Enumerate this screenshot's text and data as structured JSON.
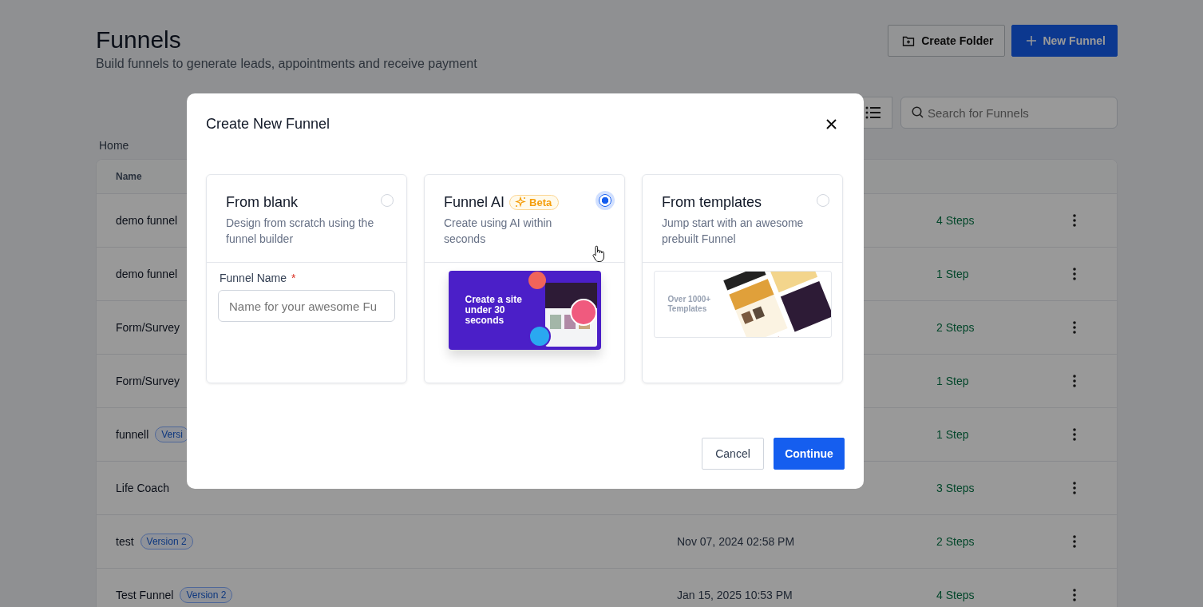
{
  "page": {
    "title": "Funnels",
    "subtitle": "Build funnels to generate leads, appointments and receive payment"
  },
  "actions": [
    {
      "kind": "secondary",
      "label": "Create Folder"
    },
    {
      "kind": "primary",
      "label": "New Funnel"
    }
  ],
  "search": {
    "placeholder": "Search for Funnels"
  },
  "breadcrumb": "Home",
  "table": {
    "columns": [
      "Name"
    ],
    "rows": [
      {
        "name": "demo funnel",
        "steps": "4 Steps"
      },
      {
        "name": "demo funnel",
        "steps": "1 Step"
      },
      {
        "name": "Form/Survey",
        "steps": "2 Steps"
      },
      {
        "name": "Form/Survey",
        "steps": "1 Step"
      },
      {
        "name": "funnell",
        "badge": "Versi",
        "steps": "1 Step"
      },
      {
        "name": "Life Coach",
        "steps": "3 Steps"
      },
      {
        "name": "test",
        "badge": "Version 2",
        "date": "Nov 07, 2024 02:58 PM",
        "steps": "2 Steps"
      },
      {
        "name": "Test Funnel",
        "badge": "Version 2",
        "date": "Jan 15, 2025 10:53 PM",
        "steps": "4 Steps"
      }
    ]
  },
  "modal": {
    "title": "Create New Funnel",
    "options": [
      {
        "kind": "blank",
        "title": "From blank",
        "description": "Design from scratch using the funnel builder",
        "selected": false,
        "field_label": "Funnel Name",
        "required_mark": "*",
        "placeholder": "Name for your awesome Fu"
      },
      {
        "kind": "ai",
        "title": "Funnel AI",
        "badge": "Beta",
        "description": "Create using AI within seconds",
        "selected": true,
        "banner": "Create a site under 30 seconds"
      },
      {
        "kind": "templates",
        "title": "From templates",
        "description": "Jump start with an awesome prebuilt Funnel",
        "selected": false,
        "banner": "Over 1000+ Templates"
      }
    ],
    "buttons": [
      {
        "kind": "secondary",
        "label": "Cancel"
      },
      {
        "kind": "primary",
        "label": "Continue"
      }
    ]
  }
}
